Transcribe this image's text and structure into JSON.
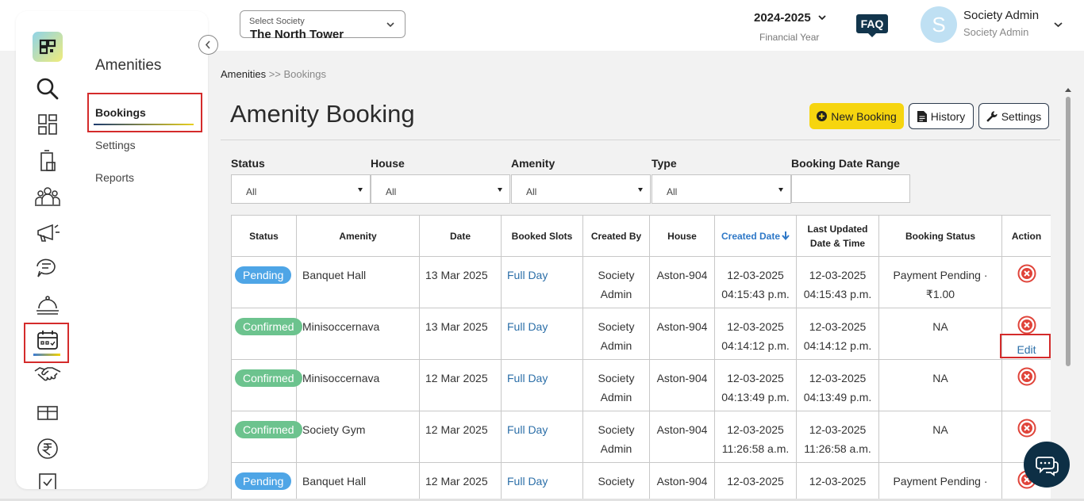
{
  "header": {
    "society_select_label": "Select Society",
    "society_select_value": "The North Tower",
    "financial_year": "2024-2025",
    "financial_year_label": "Financial Year",
    "faq_label": "FAQ",
    "user_initial": "S",
    "user_name": "Society Admin",
    "user_role": "Society Admin"
  },
  "sidebar": {
    "icons": [
      "search-icon",
      "dashboard-icon",
      "building-icon",
      "members-icon",
      "announcement-icon",
      "chat-icon",
      "service-icon",
      "calendar-icon",
      "handshake-icon",
      "gift-icon",
      "rupee-icon",
      "more-icon"
    ],
    "section_title": "Amenities",
    "sub_items": [
      {
        "label": "Bookings",
        "active": true
      },
      {
        "label": "Settings",
        "active": false
      },
      {
        "label": "Reports",
        "active": false
      }
    ]
  },
  "breadcrumb": {
    "root": "Amenities",
    "separator": " >> ",
    "current": "Bookings"
  },
  "page": {
    "title": "Amenity Booking",
    "new_booking_label": "New Booking",
    "history_label": "History",
    "settings_label": "Settings"
  },
  "filters": [
    {
      "label": "Status",
      "value": "All"
    },
    {
      "label": "House",
      "value": "All"
    },
    {
      "label": "Amenity",
      "value": "All"
    },
    {
      "label": "Type",
      "value": "All"
    },
    {
      "label": "Booking Date Range",
      "value": ""
    }
  ],
  "table": {
    "columns": [
      "Status",
      "Amenity",
      "Date",
      "Booked Slots",
      "Created By",
      "House",
      "Created Date",
      "Last Updated Date & Time",
      "Booking Status",
      "Action"
    ],
    "rows": [
      {
        "status": "Pending",
        "amenity": "Banquet Hall",
        "date": "13 Mar 2025",
        "slots": "Full Day",
        "created_by": "Society Admin",
        "house": "Aston-904",
        "created_date": "12-03-2025",
        "created_time": "04:15:43 p.m.",
        "updated_date": "12-03-2025",
        "updated_time": "04:15:43 p.m.",
        "booking_status": "Payment Pending ·",
        "booking_status_2": "₹1.00",
        "edit": ""
      },
      {
        "status": "Confirmed",
        "amenity": "Minisoccernava",
        "date": "13 Mar 2025",
        "slots": "Full Day",
        "created_by": "Society Admin",
        "house": "Aston-904",
        "created_date": "12-03-2025",
        "created_time": "04:14:12 p.m.",
        "updated_date": "12-03-2025",
        "updated_time": "04:14:12 p.m.",
        "booking_status": "NA",
        "booking_status_2": "",
        "edit": "Edit"
      },
      {
        "status": "Confirmed",
        "amenity": "Minisoccernava",
        "date": "12 Mar 2025",
        "slots": "Full Day",
        "created_by": "Society Admin",
        "house": "Aston-904",
        "created_date": "12-03-2025",
        "created_time": "04:13:49 p.m.",
        "updated_date": "12-03-2025",
        "updated_time": "04:13:49 p.m.",
        "booking_status": "NA",
        "booking_status_2": "",
        "edit": ""
      },
      {
        "status": "Confirmed",
        "amenity": "Society Gym",
        "date": "12 Mar 2025",
        "slots": "Full Day",
        "created_by": "Society Admin",
        "house": "Aston-904",
        "created_date": "12-03-2025",
        "created_time": "11:26:58 a.m.",
        "updated_date": "12-03-2025",
        "updated_time": "11:26:58 a.m.",
        "booking_status": "NA",
        "booking_status_2": "",
        "edit": ""
      },
      {
        "status": "Pending",
        "amenity": "Banquet Hall",
        "date": "12 Mar 2025",
        "slots": "Full Day",
        "created_by": "Society",
        "house": "Aston-904",
        "created_date": "12-03-2025",
        "created_time": "",
        "updated_date": "12-03-2025",
        "updated_time": "",
        "booking_status": "Payment Pending ·",
        "booking_status_2": "",
        "edit": ""
      }
    ]
  },
  "colors": {
    "accent_yellow": "#f6d50f",
    "pending": "#4ea5e6",
    "confirmed": "#6cc38e",
    "link": "#2c6fa8",
    "danger": "#e0443a"
  }
}
